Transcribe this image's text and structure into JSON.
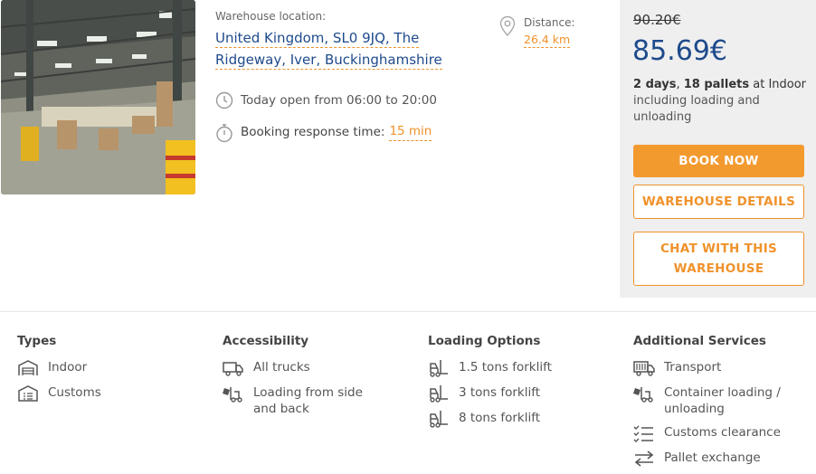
{
  "listing": {
    "location_label": "Warehouse location:",
    "address": "United Kingdom, SL0 9JQ, The Ridgeway, Iver, Buckinghamshire",
    "hours": "Today open from 06:00 to 20:00",
    "response_label": "Booking response time:",
    "response_value": "15 min",
    "distance_label": "Distance:",
    "distance_value": "26.4 km"
  },
  "pricing": {
    "old_price": "90.20€",
    "new_price": "85.69€",
    "desc_days": "2 days",
    "desc_sep": ", ",
    "desc_pallets": "18 pallets",
    "desc_at": " at ",
    "desc_type": "Indoor",
    "desc_rest": "including loading and unloading",
    "book_label": "BOOK NOW",
    "details_label": "WAREHOUSE DETAILS",
    "chat_label": "CHAT WITH THIS WAREHOUSE"
  },
  "features": {
    "types": {
      "title": "Types",
      "items": [
        {
          "label": "Indoor",
          "icon": "warehouse-icon"
        },
        {
          "label": "Customs",
          "icon": "customs-icon"
        }
      ]
    },
    "accessibility": {
      "title": "Accessibility",
      "items": [
        {
          "label": "All trucks",
          "icon": "truck-icon"
        },
        {
          "label": "Loading from side and back",
          "icon": "forklift-loading-icon"
        }
      ]
    },
    "loading": {
      "title": "Loading Options",
      "items": [
        {
          "label": "1.5 tons forklift",
          "icon": "forklift-icon"
        },
        {
          "label": "3 tons forklift",
          "icon": "forklift-icon"
        },
        {
          "label": "8 tons forklift",
          "icon": "forklift-icon"
        }
      ]
    },
    "services": {
      "title": "Additional Services",
      "items": [
        {
          "label": "Transport",
          "icon": "transport-truck-icon"
        },
        {
          "label": "Container loading / unloading",
          "icon": "container-loading-icon"
        },
        {
          "label": "Customs clearance",
          "icon": "checklist-icon"
        },
        {
          "label": "Pallet exchange",
          "icon": "exchange-arrows-icon"
        }
      ]
    }
  },
  "colors": {
    "accent": "#f39a2e",
    "price_blue": "#1e4a8c",
    "panel_bg": "#efefef"
  }
}
